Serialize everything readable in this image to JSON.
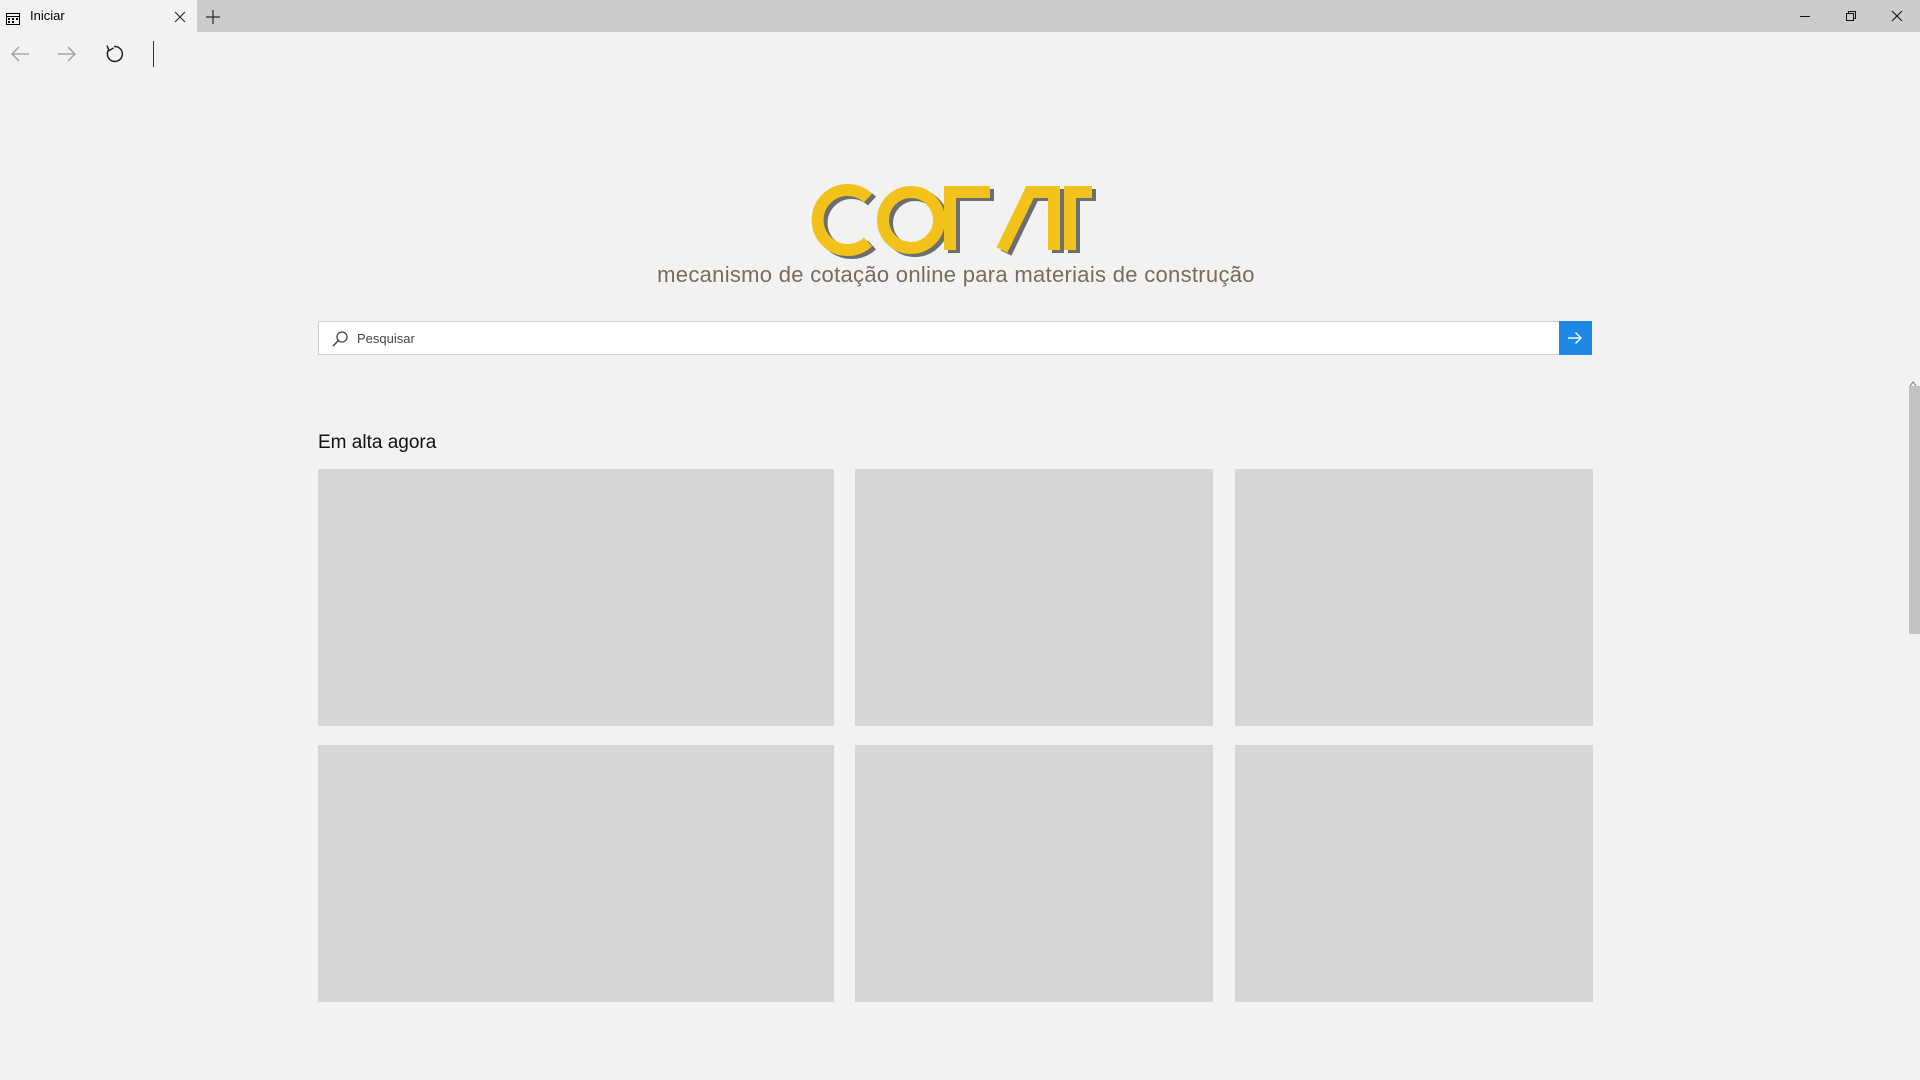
{
  "tab": {
    "title": "Iniciar",
    "favicon": "reading-view-icon",
    "close": "close-icon"
  },
  "new_tab": "plus-icon",
  "window_controls": [
    "minimize-icon",
    "restore-icon",
    "close-icon"
  ],
  "navigation": {
    "back": "arrow-left-icon",
    "forward": "arrow-right-icon",
    "refresh": "refresh-icon"
  },
  "brand": {
    "logo_text": "COTAR",
    "logo_color": "#f2c21b",
    "logo_shadow_color": "#6e6e6e",
    "tagline": "mecanismo de cotação online para materiais de construção",
    "tagline_color": "#7b6a58"
  },
  "search": {
    "placeholder": "Pesquisar",
    "value": "",
    "go_icon": "arrow-right-icon",
    "accent": "#1e88e5"
  },
  "trending": {
    "title": "Em alta agora",
    "card_color": "#d6d6d6",
    "cards": [
      "",
      "",
      "",
      "",
      "",
      ""
    ]
  }
}
